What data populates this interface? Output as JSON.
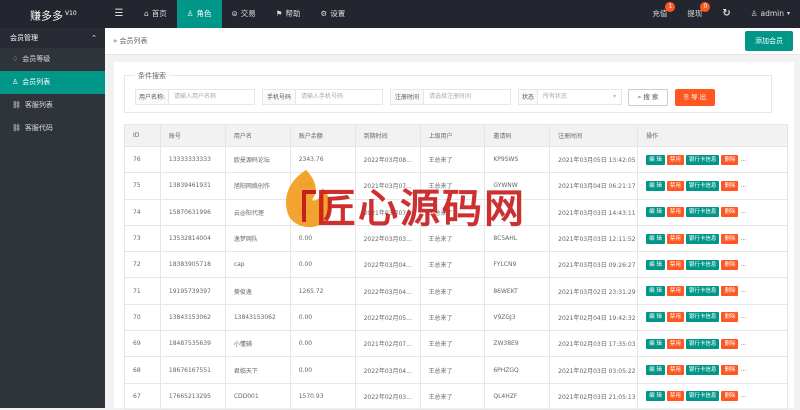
{
  "brand": {
    "name": "赚多多",
    "version": "V10"
  },
  "nav": [
    {
      "label": "首页",
      "icon": "home-icon"
    },
    {
      "label": "角色",
      "icon": "user-icon"
    },
    {
      "label": "交易",
      "icon": "trade-icon"
    },
    {
      "label": "帮助",
      "icon": "flag-icon"
    },
    {
      "label": "设置",
      "icon": "gear-icon"
    }
  ],
  "right_nav": {
    "recharge": {
      "label": "充值",
      "badge": "1"
    },
    "withdraw": {
      "label": "提现",
      "badge": "0"
    },
    "user": "admin"
  },
  "sidebar": {
    "header": "会员管理",
    "items": [
      {
        "label": "会员等级"
      },
      {
        "label": "会员列表"
      },
      {
        "label": "客服列表"
      },
      {
        "label": "客服代码"
      }
    ]
  },
  "breadcrumb": "会员列表",
  "add_button": "添加会员",
  "search": {
    "legend": "条件搜索",
    "username_label": "用户名称:",
    "username_placeholder": "请输入用户名称",
    "phone_label": "手机号码",
    "phone_placeholder": "请输入手机号码",
    "regtime_label": "注册时间",
    "regtime_placeholder": "请选择注册时间",
    "status_label": "状态",
    "status_placeholder": "所有状态",
    "search_btn": "搜 索",
    "export_btn": "导 出"
  },
  "table": {
    "headers": [
      "ID",
      "账号",
      "用户名",
      "账户余额",
      "到期时间",
      "上级用户",
      "邀请码",
      "注册时间",
      "操作"
    ],
    "actions": [
      "编 辑",
      "禁用",
      "银行卡信息",
      "删除",
      "..."
    ],
    "rows": [
      [
        "76",
        "13333333333",
        "欧曼源码论坛",
        "2343.76",
        "2022年03月08...",
        "王总来了",
        "KP9SWS",
        "2021年03月05日 13:42:05"
      ],
      [
        "75",
        "13839461931",
        "旭阳网络创作",
        "0.00",
        "2021年03月07...",
        "王总来了",
        "GYWNW",
        "2021年03月04日 06:21:17"
      ],
      [
        "74",
        "15870631996",
        "云@阳代理",
        "0.00",
        "2021年03月07...",
        "王总来了",
        "",
        "2021年03月03日 14:43:11"
      ],
      [
        "73",
        "13532814004",
        "逸梦网队",
        "0.00",
        "2022年03月03...",
        "王总来了",
        "8C5AHL",
        "2021年03月03日 12:11:52"
      ],
      [
        "72",
        "18383905718",
        "cap",
        "0.00",
        "2022年03月04...",
        "王总来了",
        "FYLCN9",
        "2021年03月03日 09:26:27"
      ],
      [
        "71",
        "19195739397",
        "葵俊逸",
        "1265.72",
        "2022年03月04...",
        "王总来了",
        "86WEKT",
        "2021年03月02日 23:31:29"
      ],
      [
        "70",
        "13843153062",
        "13843153062",
        "0.00",
        "2022年02月05...",
        "王总来了",
        "V9ZGJ3",
        "2021年02月04日 19:42:32"
      ],
      [
        "69",
        "18487535639",
        "小懂辅",
        "0.00",
        "2021年02月07...",
        "王总来了",
        "ZW38E9",
        "2021年02月03日 17:35:03"
      ],
      [
        "68",
        "18676167551",
        "君临天下",
        "0.00",
        "2022年03月04...",
        "王总来了",
        "6PHZGQ",
        "2021年02月03日 03:05:22"
      ],
      [
        "67",
        "17665213295",
        "CDD001",
        "1570.93",
        "2022年02月03...",
        "王总来了",
        "QL4HZF",
        "2021年02月03日 21:05:13"
      ]
    ]
  },
  "watermark": "匠心源码网",
  "colors": {
    "primary": "#009688",
    "danger": "#ff5722",
    "topbar": "#23262e",
    "sidebar": "#2f343b"
  }
}
